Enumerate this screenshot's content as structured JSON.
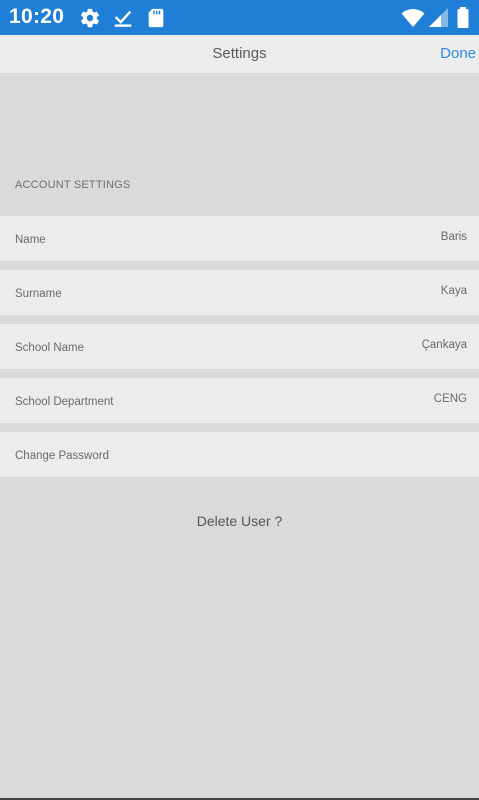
{
  "status_bar": {
    "time": "10:20",
    "icons": [
      "gear-icon",
      "download-done-icon",
      "sd-card-icon",
      "wifi-icon",
      "cell-signal-icon",
      "battery-icon"
    ]
  },
  "app_bar": {
    "title": "Settings",
    "done_label": "Done"
  },
  "account_section": {
    "header": "ACCOUNT SETTINGS",
    "rows": [
      {
        "label": "Name",
        "value": "Baris"
      },
      {
        "label": "Surname",
        "value": "Kaya"
      },
      {
        "label": "School Name",
        "value": "Çankaya"
      },
      {
        "label": "School Department",
        "value": "CENG"
      },
      {
        "label": "Change Password",
        "value": ""
      }
    ]
  },
  "delete_user_label": "Delete User ?",
  "colors": {
    "status_bar": "#1f7fd6",
    "background": "#dadada",
    "row_background": "#ececec",
    "accent": "#2f8ae0"
  }
}
